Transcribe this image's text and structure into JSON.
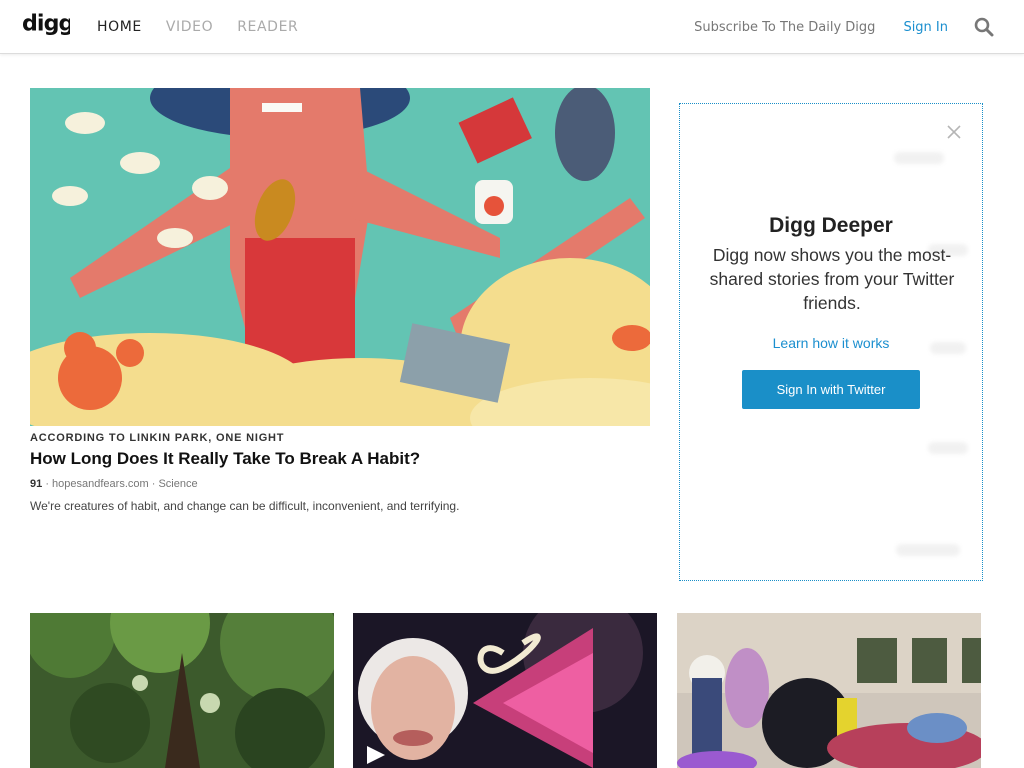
{
  "header": {
    "logo_text": "digg",
    "nav": [
      {
        "label": "HOME",
        "active": true
      },
      {
        "label": "VIDEO",
        "active": false
      },
      {
        "label": "READER",
        "active": false
      }
    ],
    "subscribe_label": "Subscribe To The Daily Digg",
    "signin_label": "Sign In",
    "search_icon": "search-icon"
  },
  "feature": {
    "kicker": "ACCORDING TO LINKIN PARK, ONE NIGHT",
    "headline": "How Long Does It Really Take To Break A Habit?",
    "score": "91",
    "source": "hopesandfears.com",
    "category": "Science",
    "separator": "·",
    "dek": "We're creatures of habit, and change can be difficult, inconvenient, and terrifying."
  },
  "deeper": {
    "title": "Digg Deeper",
    "text": "Digg now shows you the most-shared stories from your Twitter friends.",
    "learn_label": "Learn how it works",
    "button_label": "Sign In with Twitter",
    "close_icon": "close-icon"
  },
  "tiles": [
    {
      "name": "forest-canopy-image"
    },
    {
      "name": "woman-triangle-video-thumbnail",
      "play_icon": "play-icon"
    },
    {
      "name": "refugee-children-image"
    }
  ],
  "colors": {
    "accent": "#1a8fc8",
    "nav_inactive": "#aaaaaa",
    "text": "#111111"
  }
}
